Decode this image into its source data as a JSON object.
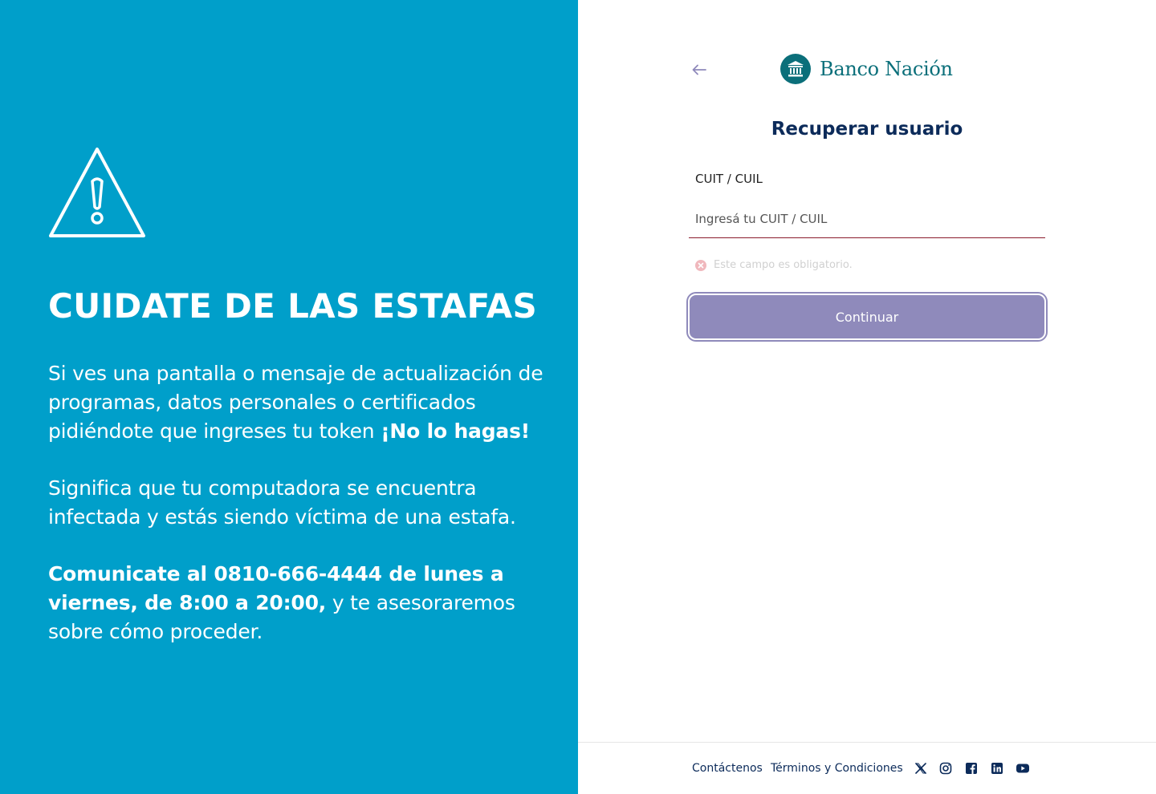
{
  "promo": {
    "heading": "CUIDATE DE LAS ESTAFAS",
    "p1_text": "Si ves una pantalla o mensaje de actualización de programas, datos personales o certificados pidiéndote que ingreses tu token ",
    "p1_bold": "¡No lo hagas!",
    "p2_text": "Significa que tu computadora se encuentra infectada y estás siendo víctima de una estafa.",
    "p3_bold": "Comunicate al 0810-666-4444 de lunes a viernes, de 8:00 a 20:00,",
    "p3_text": " y te asesoraremos sobre cómo proceder.",
    "icon": "warning-triangle-icon"
  },
  "panel": {
    "brand": "Banco Nación",
    "title": "Recuperar usuario",
    "field_label": "CUIT / CUIL",
    "field_placeholder": "Ingresá tu CUIT / CUIL",
    "field_value": "",
    "error_message": "Este campo es obligatorio.",
    "continue_label": "Continuar"
  },
  "footer": {
    "contact_label": "Contáctenos",
    "terms_label": "Términos y Condiciones",
    "social": [
      "x-icon",
      "instagram-icon",
      "facebook-icon",
      "linkedin-icon",
      "youtube-icon"
    ]
  },
  "colors": {
    "promo_bg": "#009fca",
    "brand": "#0b6f7a",
    "title": "#0c2b5a",
    "input_underline": "#8a1c2c",
    "button_bg": "#8f8abb"
  }
}
